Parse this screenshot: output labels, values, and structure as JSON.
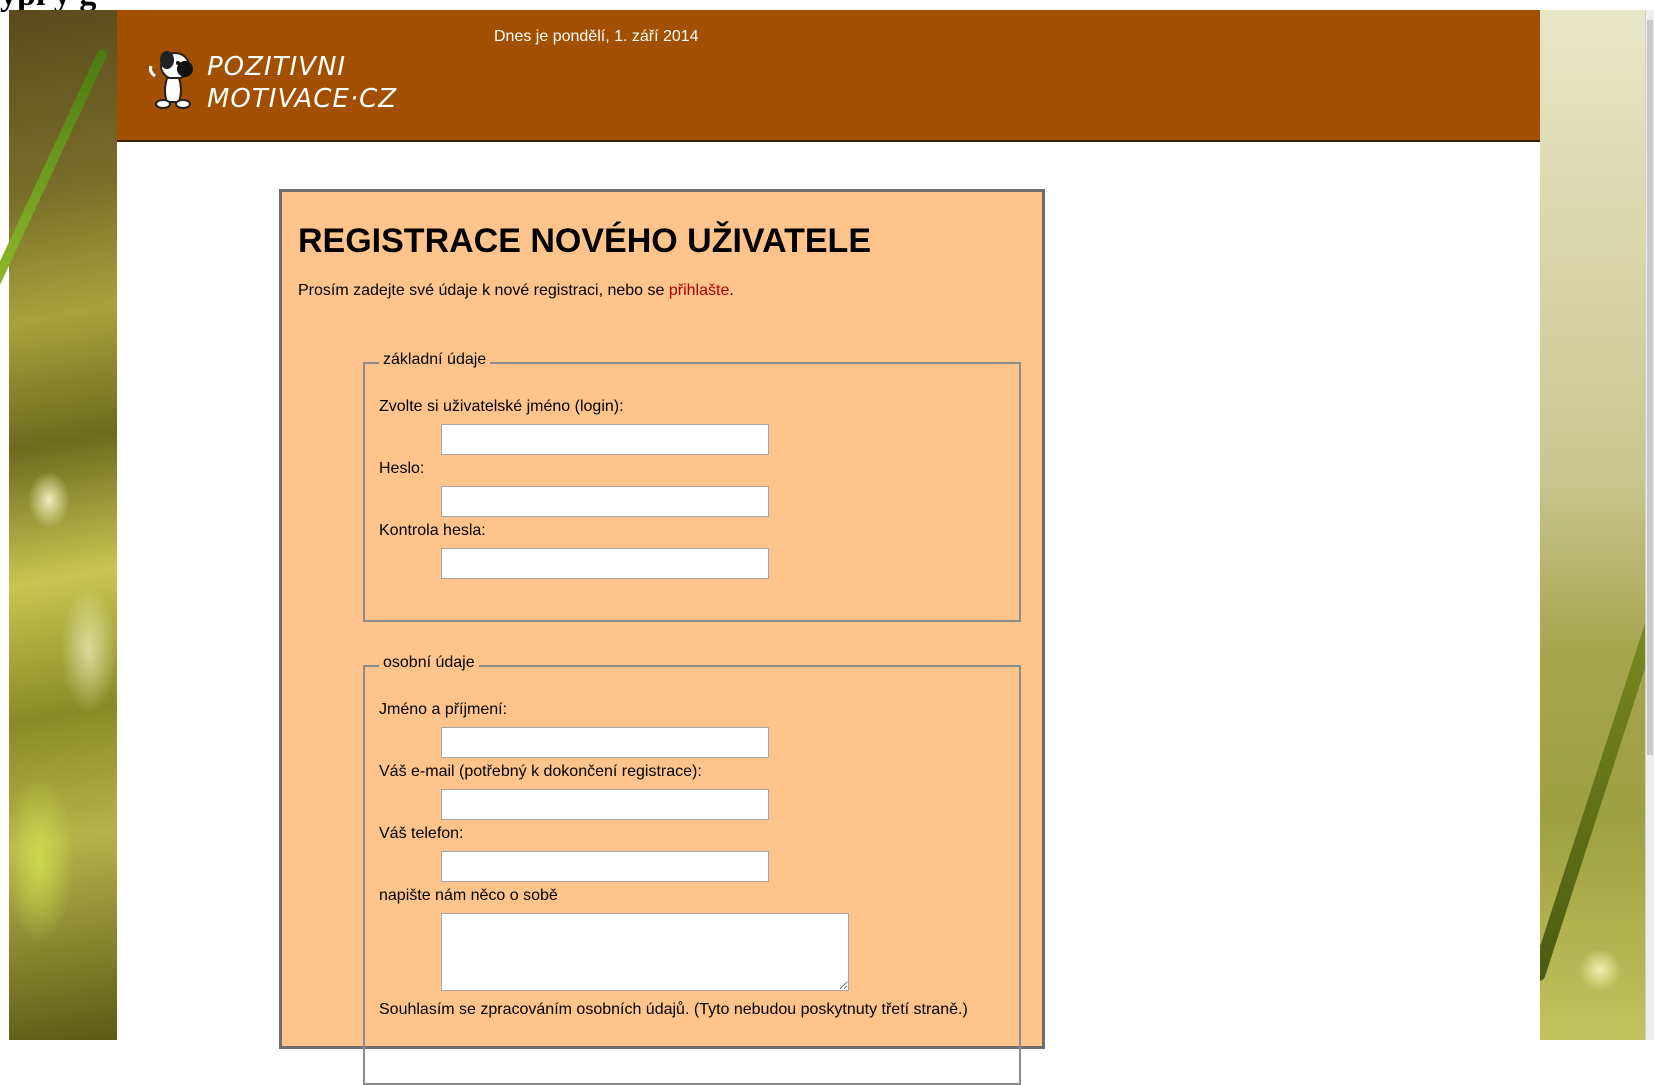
{
  "page": {
    "top_heading": "ypi     y g"
  },
  "header": {
    "logo_line1": "POZITIVNI",
    "logo_line2": "MOTIVACE·CZ",
    "date_text": "Dnes je pondělí, 1. září 2014",
    "background_color": "#a24f00"
  },
  "form": {
    "title": "REGISTRACE NOVÉHO UŽIVATELE",
    "intro_text": "Prosím zadejte své údaje k nové registraci, nebo se",
    "intro_link": "přihlašte",
    "intro_end": ".",
    "panel_color": "#ffc48c",
    "basic": {
      "legend": "základní údaje",
      "login_label": "Zvolte si uživatelské jméno (login):",
      "login_value": "",
      "password_label": "Heslo:",
      "password_value": "",
      "password_check_label": "Kontrola hesla:",
      "password_check_value": ""
    },
    "personal": {
      "legend": "osobní údaje",
      "name_label": "Jméno a příjmení:",
      "name_value": "",
      "email_label": "Váš e-mail (potřebný k dokončení registrace):",
      "email_value": "",
      "phone_label": "Váš telefon:",
      "phone_value": "",
      "about_label": "napište nám něco o sobě",
      "about_value": "",
      "consent_label": "Souhlasím se zpracováním osobních údajů. (Tyto nebudou poskytnuty třetí straně.)"
    }
  }
}
